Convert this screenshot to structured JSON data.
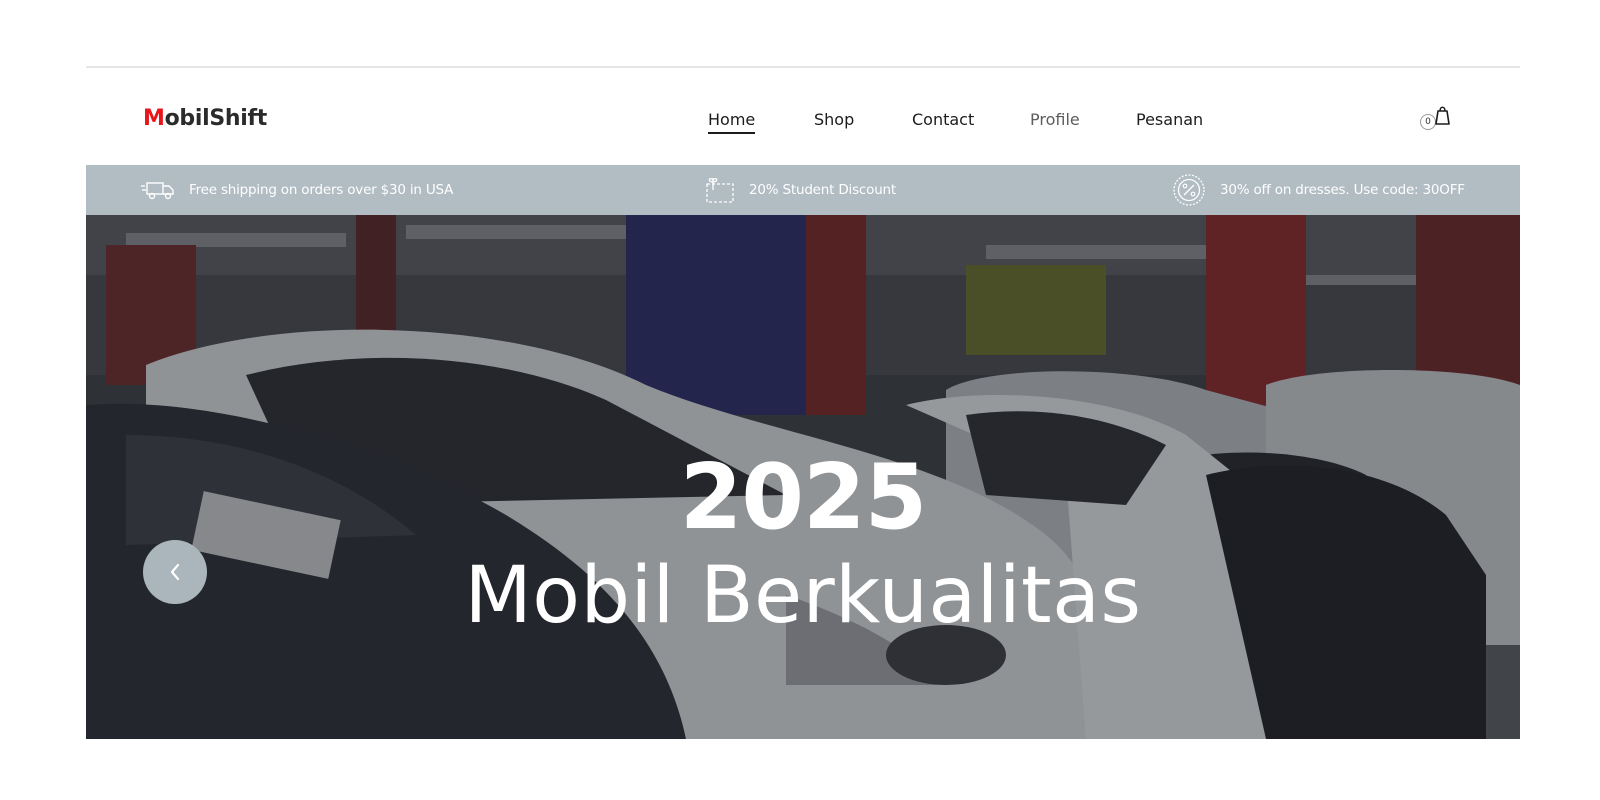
{
  "brand": {
    "initial": "M",
    "rest": "obilShift",
    "accent": "#e8161b"
  },
  "nav": {
    "items": [
      {
        "label": "Home",
        "state": "active"
      },
      {
        "label": "Shop"
      },
      {
        "label": "Contact"
      },
      {
        "label": "Profile",
        "state": "muted"
      },
      {
        "label": "Pesanan"
      }
    ]
  },
  "cart": {
    "count": "0",
    "icon": "shopping-bag-icon"
  },
  "promo": {
    "background": "#b1bcc3",
    "items": [
      {
        "icon": "truck-icon",
        "text": "Free shipping on orders over $30 in USA"
      },
      {
        "icon": "gift-icon",
        "text": "20% Student Discount"
      },
      {
        "icon": "percent-badge-icon",
        "text": "30% off on dresses. Use code: 30OFF"
      }
    ]
  },
  "hero": {
    "title": "2025",
    "subtitle": "Mobil Berkualitas",
    "prev_icon": "chevron-left-icon"
  }
}
